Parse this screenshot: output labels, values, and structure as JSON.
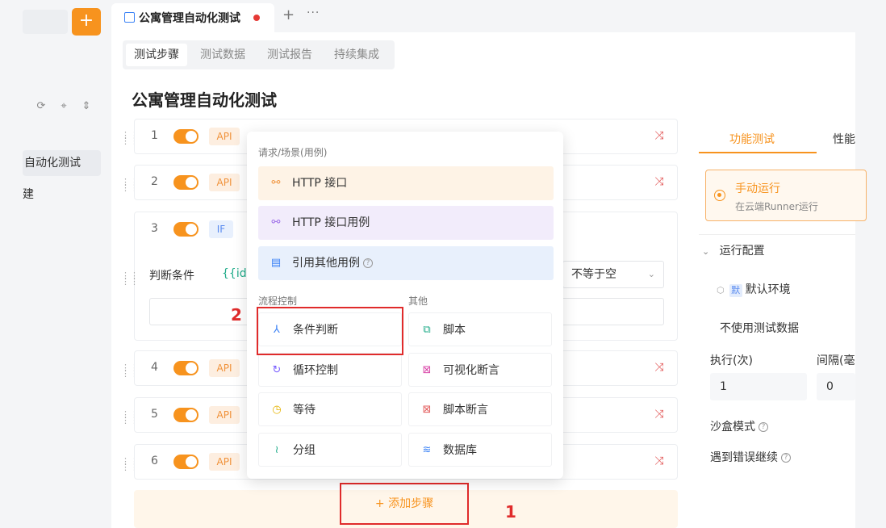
{
  "sidebar": {
    "add_label": "+",
    "active_item": "自动化测试",
    "item2": "建"
  },
  "tabbar": {
    "doc_title": "公寓管理自动化测试",
    "plus": "+",
    "more": "···"
  },
  "subtabs": [
    "测试步骤",
    "测试数据",
    "测试报告",
    "持续集成"
  ],
  "page_title": "公寓管理自动化测试",
  "steps": [
    {
      "num": "1",
      "badge": "API"
    },
    {
      "num": "2",
      "badge": "API"
    },
    {
      "num": "3",
      "badge": "IF"
    },
    {
      "num": "4",
      "badge": "API"
    },
    {
      "num": "5",
      "badge": "API"
    },
    {
      "num": "6",
      "badge": "API"
    }
  ],
  "condition": {
    "label": "判断条件",
    "variable": "{{id}}",
    "operator": "不等于空"
  },
  "popup": {
    "section_request": "请求/场景(用例)",
    "http": "HTTP 接口",
    "http_case": "HTTP 接口用例",
    "ref_case": "引用其他用例",
    "section_flow": "流程控制",
    "section_other": "其他",
    "if_cond": "条件判断",
    "script": "脚本",
    "loop": "循环控制",
    "visual_assert": "可视化断言",
    "wait": "等待",
    "script_assert": "脚本断言",
    "group": "分组",
    "database": "数据库"
  },
  "add_step": "+ 添加步骤",
  "annotations": {
    "one": "1",
    "two": "2"
  },
  "right_panel": {
    "tab_functional": "功能测试",
    "tab_perf": "性能",
    "run_title": "手动运行",
    "run_sub": "在云端Runner运行",
    "config": "运行配置",
    "env": "默认环境",
    "env_badge": "默",
    "no_data": "不使用测试数据",
    "exec_label": "执行(次)",
    "interval_label": "间隔(毫",
    "exec_value": "1",
    "interval_value": "0",
    "sandbox": "沙盒模式",
    "continue_on_error": "遇到错误继续"
  },
  "colors": {
    "accent": "#f7931e",
    "annotation": "#e02b2b"
  }
}
